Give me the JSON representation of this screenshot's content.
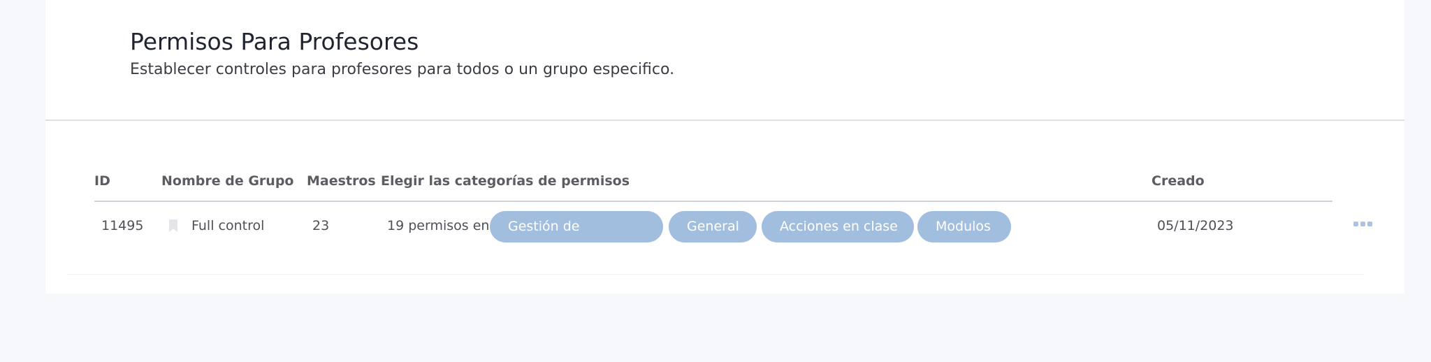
{
  "page": {
    "title": "Permisos Para Profesores",
    "subtitle": "Establecer controles para profesores para todos o un grupo especifico."
  },
  "table": {
    "columns": {
      "id": "ID",
      "group_name": "Nombre de Grupo",
      "teachers": "Maestros",
      "categories": "Elegir las categorías de permisos",
      "created": "Creado"
    },
    "rows": [
      {
        "id": "11495",
        "group_name": "Full control",
        "teachers": "23",
        "permissions_prefix": "19 permisos en",
        "tags": [
          "Gestión de",
          "General",
          "Acciones en clase",
          "Modulos"
        ],
        "created": "05/11/2023"
      }
    ]
  },
  "icons": {
    "bookmark": "bookmark-icon",
    "more": "more-options-icon"
  },
  "colors": {
    "pill": "#a2bede",
    "accent_dots": "#a9c3e6"
  }
}
